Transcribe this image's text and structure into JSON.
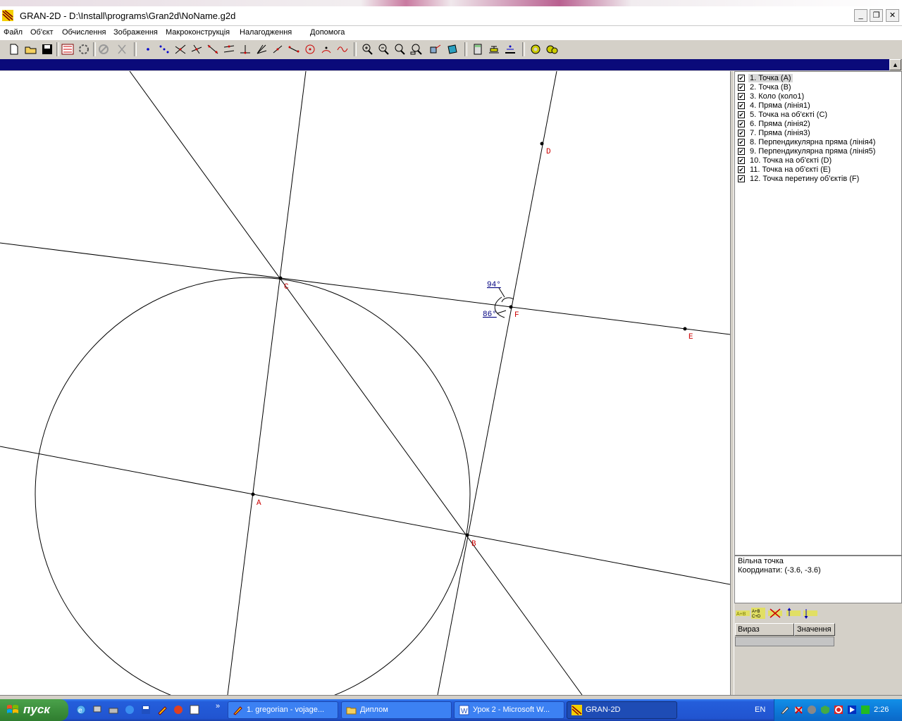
{
  "window": {
    "title": "GRAN-2D - D:\\Install\\programs\\Gran2d\\NoName.g2d",
    "minimize": "_",
    "maximize": "❐",
    "close": "✕"
  },
  "menu": [
    "Файл",
    "Об'єкт",
    "Обчислення",
    "Зображення",
    "Макроконструкція",
    "Налагодження",
    "Допомога"
  ],
  "canvas": {
    "labels": {
      "A": "A",
      "B": "B",
      "C": "C",
      "D": "D",
      "E": "E",
      "F": "F",
      "angle1": "94°",
      "angle2": "86°"
    }
  },
  "objects": [
    "1. Точка (A)",
    "2. Точка (B)",
    "3. Коло (коло1)",
    "4. Пряма (лінія1)",
    "5. Точка на об'єкті (C)",
    "6. Пряма (лінія2)",
    "7. Пряма (лінія3)",
    "8. Перпендикулярна пряма (лінія4)",
    "9. Перпендикулярна пряма (лінія5)",
    "10. Точка на об'єкті (D)",
    "11. Точка на об'єкті (E)",
    "12. Точка перетину об'єктів (F)"
  ],
  "info": {
    "type": "Вільна точка",
    "coords": "Координати: (-3.6, -3.6)"
  },
  "calc": {
    "col1": "Вираз",
    "col2": "Значення"
  },
  "taskbar": {
    "start": "пуск",
    "tasks": [
      "1. gregorian - vojage...",
      "Диплом",
      "Урок 2 - Microsoft W...",
      "GRAN-2D"
    ],
    "lang": "EN",
    "clock": "2:26"
  },
  "colors": {
    "title_bg": "#ffffff",
    "bluebar": "#0a0a7a",
    "label_red": "#cc0000",
    "angle_blue": "#000080"
  }
}
